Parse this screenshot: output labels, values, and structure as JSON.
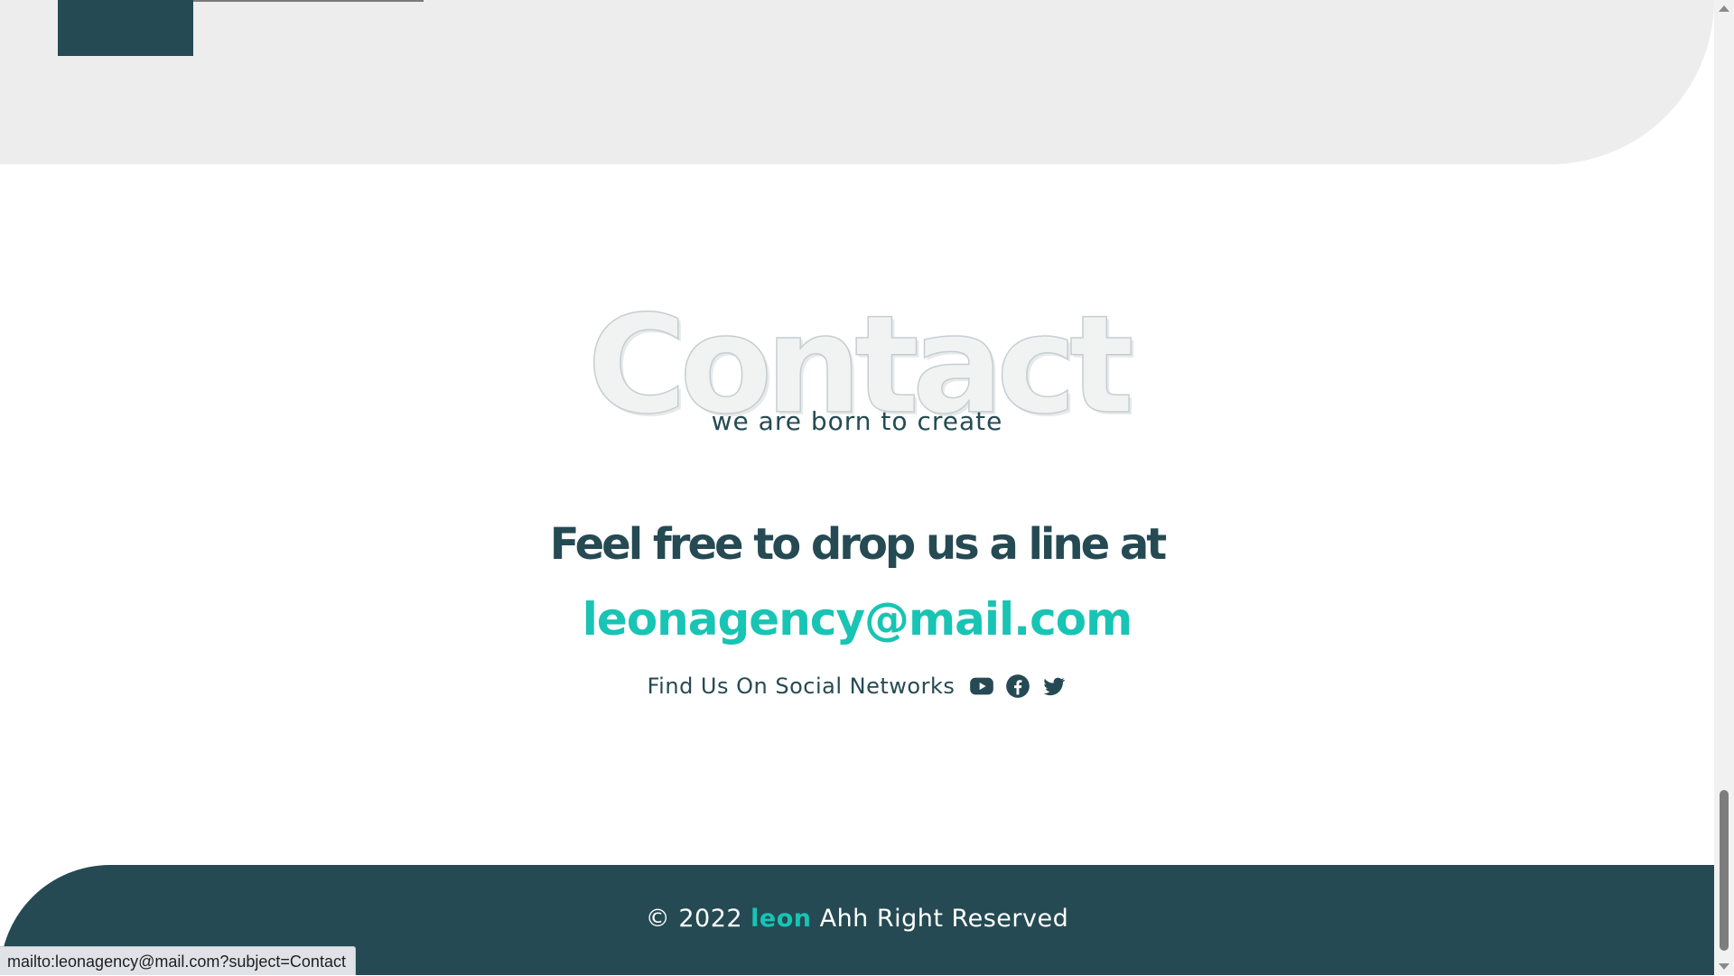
{
  "contact": {
    "bg_title": "Contact",
    "subtitle": "we are born to create",
    "heading": "Feel free to drop us a line at",
    "email": "leonagency@mail.com",
    "social_label": "Find Us On Social Networks",
    "social_icons": [
      "youtube-icon",
      "facebook-icon",
      "twitter-icon"
    ]
  },
  "footer": {
    "copyright": "© 2022",
    "brand": "leon",
    "rights": "Ahh Right Reserved"
  },
  "status_bar": {
    "url": "mailto:leonagency@mail.com?subject=Contact"
  },
  "colors": {
    "primary_dark": "#254a53",
    "accent_teal": "#18c4b4",
    "light_grey_bg": "#ededed"
  }
}
